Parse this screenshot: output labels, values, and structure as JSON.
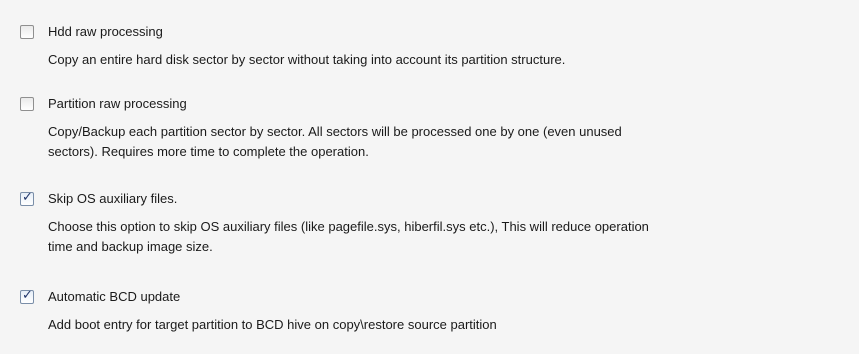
{
  "options": [
    {
      "label": "Hdd raw processing",
      "checked": false,
      "description": "Copy an entire hard disk sector by sector without taking into account its partition structure."
    },
    {
      "label": "Partition raw processing",
      "checked": false,
      "description_lines": [
        "Copy/Backup each partition sector by sector. All sectors will be processed one by one (even unused",
        "sectors). Requires more time to complete the operation."
      ]
    },
    {
      "label": "Skip OS auxiliary files.",
      "checked": true,
      "description_lines": [
        "Choose this option to skip OS auxiliary files (like pagefile.sys, hiberfil.sys etc.), This will reduce operation",
        "time and backup image size."
      ]
    },
    {
      "label": "Automatic BCD update",
      "checked": true,
      "description": "Add boot entry for target partition to BCD hive on copy\\restore source partition"
    }
  ],
  "colors": {
    "background": "#f5f5f5",
    "text": "#1a1a1a",
    "checkmark": "#21366b"
  },
  "icons": {
    "check": "check-icon"
  }
}
